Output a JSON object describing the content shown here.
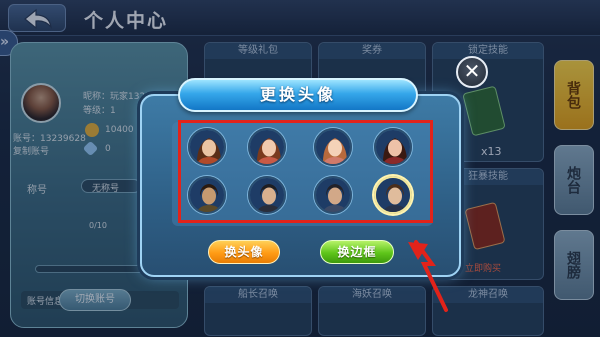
{
  "header": {
    "title": "个人中心"
  },
  "player": {
    "nickname_label": "昵称：",
    "nickname_value": "玩家1323...",
    "level_label": "等级：",
    "level_value": "1",
    "id_label": "账号：13239628",
    "sub_label": "复制账号",
    "coins": "10400",
    "gems": "0",
    "title_label": "称号",
    "title_value": "无称号",
    "progress_text": "0/10",
    "account_info": "账号信息",
    "switch_account": "切换账号"
  },
  "tiles": {
    "level_gift": "等级礼包",
    "reward": "奖券",
    "skill": "锁定技能",
    "skill_count": "x13",
    "race_skill": "狂暴技能",
    "buy_now": "立即购买",
    "captain": "船长召唤",
    "sea_monster": "海妖召唤",
    "dragon": "龙神召唤"
  },
  "side_tabs": [
    "背包",
    "炮台",
    "翅膀"
  ],
  "modal": {
    "title": "更换头像",
    "close_symbol": "✕",
    "change_avatar": "换头像",
    "change_frame": "换边框",
    "avatars": [
      {
        "name": "avatar-female-1",
        "skin": "#e9c3a3",
        "hair": "#5a2d16",
        "cloth": "#b04a2a",
        "bg": "#1e3c66"
      },
      {
        "name": "avatar-female-2",
        "skin": "#f1c9ae",
        "hair": "#7a3a1e",
        "cloth": "#c85a46",
        "bg": "#1e3c66"
      },
      {
        "name": "avatar-female-3",
        "skin": "#f4d2b8",
        "hair": "#b86a3c",
        "cloth": "#d07a6a",
        "bg": "#1e3c66"
      },
      {
        "name": "avatar-female-4",
        "skin": "#eec2a8",
        "hair": "#3a1a12",
        "cloth": "#8a2a2a",
        "bg": "#1e3c66"
      },
      {
        "name": "avatar-male-1",
        "skin": "#c69a70",
        "hair": "#2a1a10",
        "cloth": "#5a4a2a",
        "bg": "#1e3c66"
      },
      {
        "name": "avatar-male-2",
        "skin": "#d8b08e",
        "hair": "#1e1e22",
        "cloth": "#2a2e3a",
        "bg": "#1e3c66"
      },
      {
        "name": "avatar-male-3",
        "skin": "#d2a888",
        "hair": "#22222a",
        "cloth": "#3c4a66",
        "bg": "#1e3c66"
      },
      {
        "name": "avatar-male-4",
        "skin": "#e0bc9c",
        "hair": "#4a2e1c",
        "cloth": "#26324a",
        "bg": "#1e3c66"
      }
    ],
    "selected_index": 7
  },
  "colors": {
    "highlight": "#e2231a",
    "accent": "#35a7ea"
  }
}
